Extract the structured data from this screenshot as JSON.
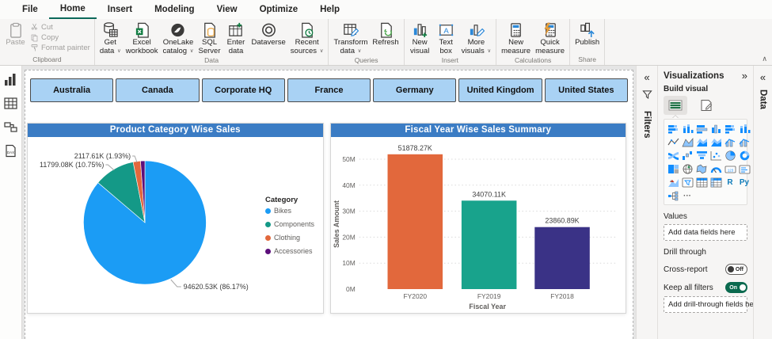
{
  "ribbon": {
    "tabs": [
      {
        "label": "File",
        "active": false
      },
      {
        "label": "Home",
        "active": true
      },
      {
        "label": "Insert",
        "active": false
      },
      {
        "label": "Modeling",
        "active": false
      },
      {
        "label": "View",
        "active": false
      },
      {
        "label": "Optimize",
        "active": false
      },
      {
        "label": "Help",
        "active": false
      }
    ],
    "groups": [
      {
        "label": "Clipboard",
        "items": [
          {
            "label": "Paste",
            "icon": "paste-icon",
            "size": "large",
            "disabled": true
          },
          {
            "label": "Cut",
            "icon": "cut-icon",
            "size": "small",
            "disabled": true
          },
          {
            "label": "Copy",
            "icon": "copy-icon",
            "size": "small",
            "disabled": true
          },
          {
            "label": "Format painter",
            "icon": "format-painter-icon",
            "size": "small",
            "disabled": true
          }
        ]
      },
      {
        "label": "Data",
        "items": [
          {
            "label": "Get data",
            "icon": "database-icon",
            "dropdown": true
          },
          {
            "label": "Excel workbook",
            "icon": "excel-icon"
          },
          {
            "label": "OneLake catalog",
            "icon": "onelake-icon",
            "dropdown": true
          },
          {
            "label": "SQL Server",
            "icon": "sql-server-icon"
          },
          {
            "label": "Enter data",
            "icon": "enter-data-icon"
          },
          {
            "label": "Dataverse",
            "icon": "dataverse-icon"
          },
          {
            "label": "Recent sources",
            "icon": "recent-sources-icon",
            "dropdown": true
          }
        ]
      },
      {
        "label": "Queries",
        "items": [
          {
            "label": "Transform data",
            "icon": "transform-data-icon",
            "dropdown": true
          },
          {
            "label": "Refresh",
            "icon": "refresh-icon"
          }
        ]
      },
      {
        "label": "Insert",
        "items": [
          {
            "label": "New visual",
            "icon": "new-visual-icon"
          },
          {
            "label": "Text box",
            "icon": "text-box-icon"
          },
          {
            "label": "More visuals",
            "icon": "more-visuals-icon",
            "dropdown": true
          }
        ]
      },
      {
        "label": "Calculations",
        "items": [
          {
            "label": "New measure",
            "icon": "new-measure-icon"
          },
          {
            "label": "Quick measure",
            "icon": "quick-measure-icon"
          }
        ]
      },
      {
        "label": "Share",
        "items": [
          {
            "label": "Publish",
            "icon": "publish-icon"
          }
        ]
      }
    ]
  },
  "side_nav": {
    "items": [
      {
        "name": "report-view",
        "icon": "report-view-icon"
      },
      {
        "name": "table-view",
        "icon": "table-view-icon"
      },
      {
        "name": "model-view",
        "icon": "model-view-icon"
      },
      {
        "name": "dax-query-view",
        "icon": "dax-query-view-icon"
      }
    ]
  },
  "canvas": {
    "slicer_buttons": [
      "Australia",
      "Canada",
      "Corporate HQ",
      "France",
      "Germany",
      "United Kingdom",
      "United States"
    ]
  },
  "chart_data": [
    {
      "type": "pie",
      "title": "Product Category Wise Sales",
      "legend_title": "Category",
      "legend_position": "right",
      "slices": [
        {
          "name": "Bikes",
          "data_label": "94620.53K (86.17%)",
          "percent": 86.17,
          "color": "#1B9CF5"
        },
        {
          "name": "Components",
          "data_label": "11799.08K (10.75%)",
          "percent": 10.75,
          "color": "#149987"
        },
        {
          "name": "Clothing",
          "data_label": "2117.61K (1.93%)",
          "percent": 1.93,
          "color": "#E2683C"
        },
        {
          "name": "Accessories",
          "data_label": "",
          "percent": 1.15,
          "color": "#5C0F7B"
        }
      ]
    },
    {
      "type": "bar",
      "title": "Fiscal Year Wise Sales Summary",
      "categories": [
        "FY2020",
        "FY2019",
        "FY2018"
      ],
      "values_millions": [
        51.878,
        34.07,
        23.861
      ],
      "data_labels": [
        "51878.27K",
        "34070.11K",
        "23860.89K"
      ],
      "bar_colors": [
        "#E2683C",
        "#18A38C",
        "#3A3286"
      ],
      "xlabel": "Fiscal Year",
      "ylabel": "Sales Amount",
      "ylim": [
        0,
        50
      ],
      "ytick_labels": [
        "0M",
        "10M",
        "20M",
        "30M",
        "40M",
        "50M"
      ],
      "grid": "dotted horizontal"
    }
  ],
  "panes": {
    "filters_collapsed": {
      "title": "Filters",
      "expand_glyph": "«"
    },
    "data_collapsed": {
      "title": "Data",
      "expand_glyph": "«"
    },
    "visualizations": {
      "title": "Visualizations",
      "collapse_glyph": "»",
      "section_build": "Build visual",
      "visual_types": [
        "stacked-bar-chart",
        "stacked-column-chart",
        "clustered-bar-chart",
        "clustered-column-chart",
        "100-stacked-bar-chart",
        "100-stacked-column-chart",
        "line-chart",
        "area-chart",
        "stacked-area-chart",
        "100-stacked-area-chart",
        "line-and-stacked-column-chart",
        "line-and-clustered-column-chart",
        "ribbon-chart",
        "waterfall-chart",
        "funnel-chart",
        "scatter-chart",
        "pie-chart",
        "donut-chart",
        "treemap",
        "map",
        "filled-map",
        "gauge",
        "card",
        "multi-row-card",
        "kpi",
        "slicer",
        "table",
        "matrix",
        "r-script-visual",
        "python-visual",
        "decomposition-tree",
        "more-visual-options"
      ],
      "more_options_glyph": "···",
      "values_label": "Values",
      "values_placeholder": "Add data fields here",
      "drill_label": "Drill through",
      "cross_report_label": "Cross-report",
      "cross_report_state": "Off",
      "keep_filters_label": "Keep all filters",
      "keep_filters_state": "On",
      "drill_placeholder": "Add drill-through fields here"
    }
  },
  "glyphs": {
    "ribbon_collapse": "∧",
    "dropdown": "∨"
  },
  "colors": {
    "visual_header": "#3B7CC4",
    "slicer_fill": "#A9D2F4",
    "active_tab_underline": "#0C695A",
    "toggle_on": "#0B6A4F",
    "canvas_background": "#E5E5E5"
  }
}
